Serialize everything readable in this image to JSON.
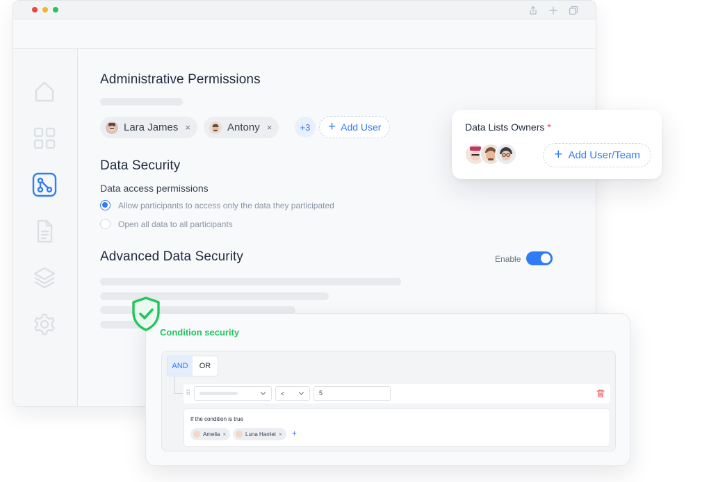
{
  "admin": {
    "title": "Administrative Permissions",
    "users": [
      {
        "name": "Lara James",
        "remove": "×"
      },
      {
        "name": "Antony",
        "remove": "×"
      }
    ],
    "more_count": "+3",
    "add_user_label": "Add User"
  },
  "data_security": {
    "title": "Data Security",
    "access_label": "Data access permissions",
    "options": [
      {
        "label": "Allow participants to access only the data they participated",
        "selected": true
      },
      {
        "label": "Open all data to all participants",
        "selected": false
      }
    ]
  },
  "advanced": {
    "title": "Advanced Data Security",
    "enable_label": "Enable",
    "enabled": true
  },
  "owners_card": {
    "title": "Data Lists Owners",
    "required_mark": "*",
    "add_label": "Add User/Team"
  },
  "condition": {
    "title": "Condition security",
    "logic_options": [
      "AND",
      "OR"
    ],
    "active_logic": "AND",
    "operator": "<",
    "value": "5",
    "then_label": "If the condition is true",
    "assignees": [
      {
        "name": "Amelia",
        "remove": "×"
      },
      {
        "name": "Luna Harriet",
        "remove": "×"
      }
    ],
    "add_symbol": "+"
  },
  "colors": {
    "accent": "#2f7cf6",
    "success": "#22c55e",
    "danger": "#ef4444"
  },
  "icons": {
    "sidebar": [
      "home-icon",
      "grid-icon",
      "workflow-icon",
      "document-icon",
      "layers-icon",
      "settings-icon"
    ],
    "titlebar": [
      "share-icon",
      "plus-icon",
      "copy-icon"
    ]
  }
}
